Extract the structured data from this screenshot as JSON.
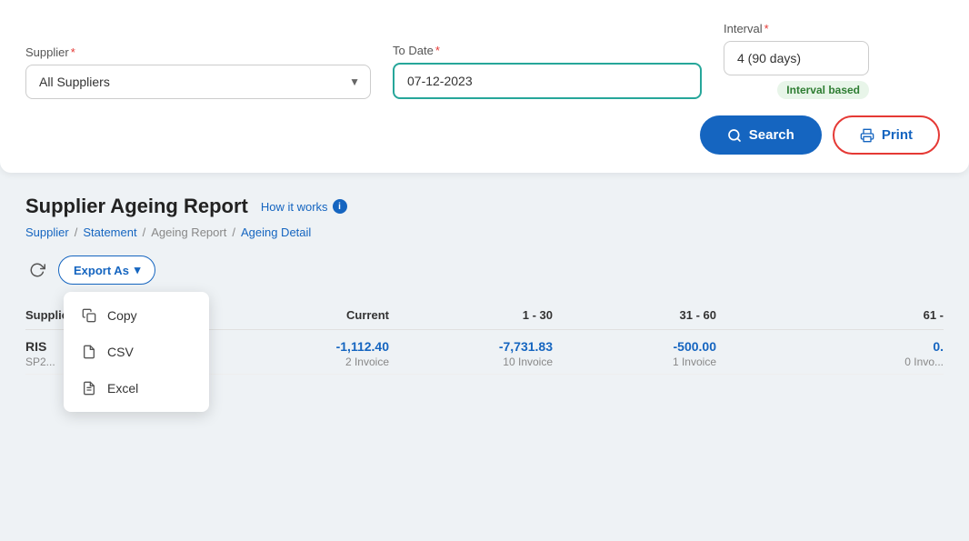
{
  "topPanel": {
    "supplierLabel": "Supplier",
    "supplierRequired": "*",
    "supplierValue": "All Suppliers",
    "supplierOptions": [
      "All Suppliers"
    ],
    "toDateLabel": "To Date",
    "toDateRequired": "*",
    "toDateValue": "07-12-2023",
    "intervalLabel": "Interval",
    "intervalRequired": "*",
    "intervalValue": "4 (90 days)",
    "intervalBadge": "Interval based"
  },
  "actions": {
    "searchLabel": "Search",
    "printLabel": "Print"
  },
  "report": {
    "title": "Supplier Ageing Report",
    "howItWorks": "How it works"
  },
  "breadcrumb": {
    "items": [
      "Supplier",
      "Statement",
      "Ageing Report",
      "Ageing Detail"
    ]
  },
  "toolbar": {
    "exportLabel": "Export As"
  },
  "dropdown": {
    "items": [
      {
        "icon": "copy",
        "label": "Copy"
      },
      {
        "icon": "csv",
        "label": "CSV"
      },
      {
        "icon": "excel",
        "label": "Excel"
      }
    ]
  },
  "table": {
    "headers": {
      "supplier": "Supplier",
      "current": "Current",
      "range1": "1 - 30",
      "range2": "31 - 60",
      "range3": "61 -"
    },
    "rows": [
      {
        "name": "RIS",
        "code": "SP2...",
        "current": "-1,112.40",
        "currentSub": "2 Invoice",
        "range1": "-7,731.83",
        "range1Sub": "10 Invoice",
        "range2": "-500.00",
        "range2Sub": "1 Invoice",
        "range3": "0.",
        "range3Sub": "0 Invo..."
      }
    ]
  },
  "colors": {
    "accent": "#1565c0",
    "negative": "#1565c0",
    "intervalBadge": "#2e7d32",
    "intervalBadgeBg": "#e8f5e9"
  }
}
